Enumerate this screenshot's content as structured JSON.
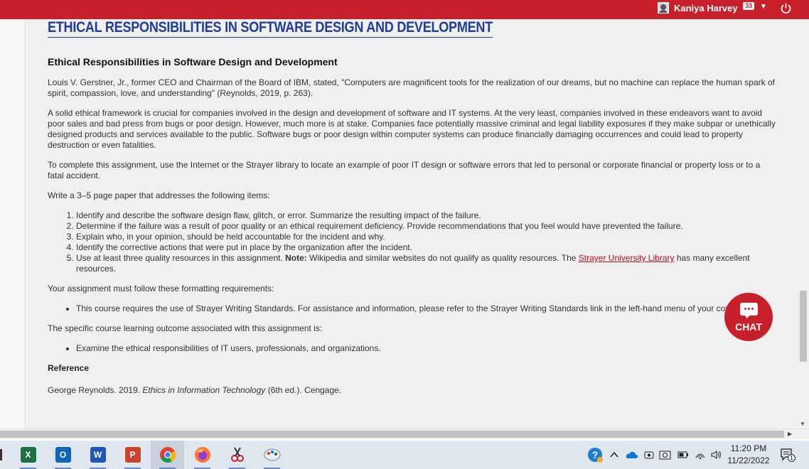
{
  "header": {
    "user_name": "Kaniya Harvey",
    "notification_count": "33",
    "brand_color": "#c8202b"
  },
  "page": {
    "title": "ETHICAL RESPONSIBILITIES IN SOFTWARE DESIGN AND DEVELOPMENT",
    "subtitle": "Ethical Responsibilities in Software Design and Development",
    "para1": "Louis V. Gerstner, Jr., former CEO and Chairman of the Board of IBM, stated, \"Computers are magnificent tools for the realization of our dreams, but no machine can replace the human spark of spirit, compassion, love, and understanding\" (Reynolds, 2019, p. 263).",
    "para2": "A solid ethical framework is crucial for companies involved in the design and development of software and IT systems. At the very least, companies involved in these endeavors want to avoid poor sales and bad press from bugs or poor design. However, much more is at stake. Companies face potentially massive criminal and legal liability exposures if they make subpar or unethically designed products and services available to the public. Software bugs or poor design within computer systems can produce financially damaging occurrences and could lead to property destruction or even fatalities.",
    "para3": "To complete this assignment, use the Internet or the Strayer library to locate an example of poor IT design or software errors that led to personal or corporate financial or property loss or to a fatal accident.",
    "para4": "Write a 3–5 page paper that addresses the following items:",
    "items": [
      "Identify and describe the software design flaw, glitch, or error. Summarize the resulting impact of the failure.",
      "Determine if the failure was a result of poor quality or an ethical requirement deficiency. Provide recommendations that you feel would have prevented the failure.",
      "Explain who, in your opinion, should be held accountable for the incident and why.",
      "Identify the corrective actions that were put in place by the organization after the incident."
    ],
    "item5": {
      "prefix": "Use at least three quality resources in this assignment. ",
      "note_label": "Note:",
      "middle": " Wikipedia and similar websites do not qualify as quality resources. The ",
      "link_text": "Strayer University Library",
      "suffix": " has many excellent resources."
    },
    "formatting_intro": "Your assignment must follow these formatting requirements:",
    "formatting_items": [
      "This course requires the use of Strayer Writing Standards. For assistance and information, please refer to the Strayer Writing Standards link in the left-hand menu of your course."
    ],
    "outcome_intro": "The specific course learning outcome associated with this assignment is:",
    "outcome_items": [
      "Examine the ethical responsibilities of IT users, professionals, and organizations."
    ],
    "reference_heading": "Reference",
    "reference": {
      "prefix": "George Reynolds. 2019. ",
      "title": "Ethics in Information Technology",
      "suffix": " (6th ed.). Cengage."
    }
  },
  "chat": {
    "label": "CHAT"
  },
  "taskbar": {
    "apps": [
      "excel-icon",
      "outlook-icon",
      "word-icon",
      "powerpoint-icon",
      "chrome-icon",
      "firefox-icon",
      "snipping-tool-icon",
      "paint-icon"
    ],
    "time": "11:20 PM",
    "date": "11/22/2022",
    "notification_count": "1"
  }
}
